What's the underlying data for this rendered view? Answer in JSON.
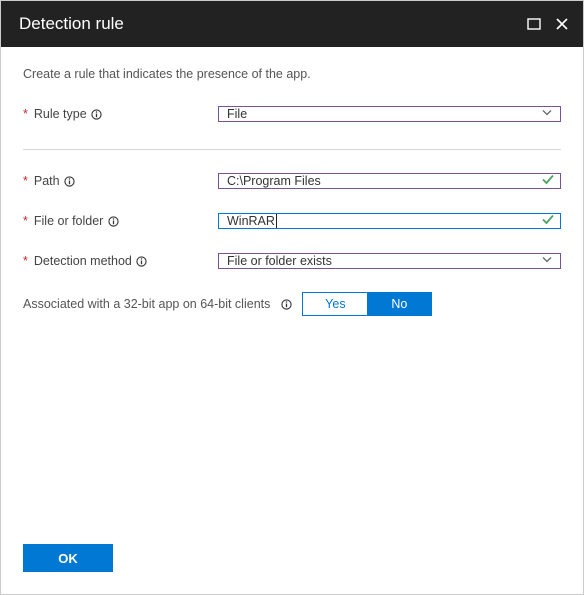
{
  "header": {
    "title": "Detection rule"
  },
  "intro": "Create a rule that indicates the presence of the app.",
  "fields": {
    "ruleType": {
      "label": "Rule type",
      "value": "File"
    },
    "path": {
      "label": "Path",
      "value": "C:\\Program Files"
    },
    "fileOrFolder": {
      "label": "File or folder",
      "value": "WinRAR"
    },
    "detectionMethod": {
      "label": "Detection method",
      "value": "File or folder exists"
    }
  },
  "toggle": {
    "label": "Associated with a 32-bit app on 64-bit clients",
    "yes": "Yes",
    "no": "No",
    "selected": "no"
  },
  "footer": {
    "ok": "OK"
  },
  "colors": {
    "accent": "#0078d4",
    "required": "#c2292e",
    "purple": "#7a5299",
    "check": "#4aa564"
  }
}
